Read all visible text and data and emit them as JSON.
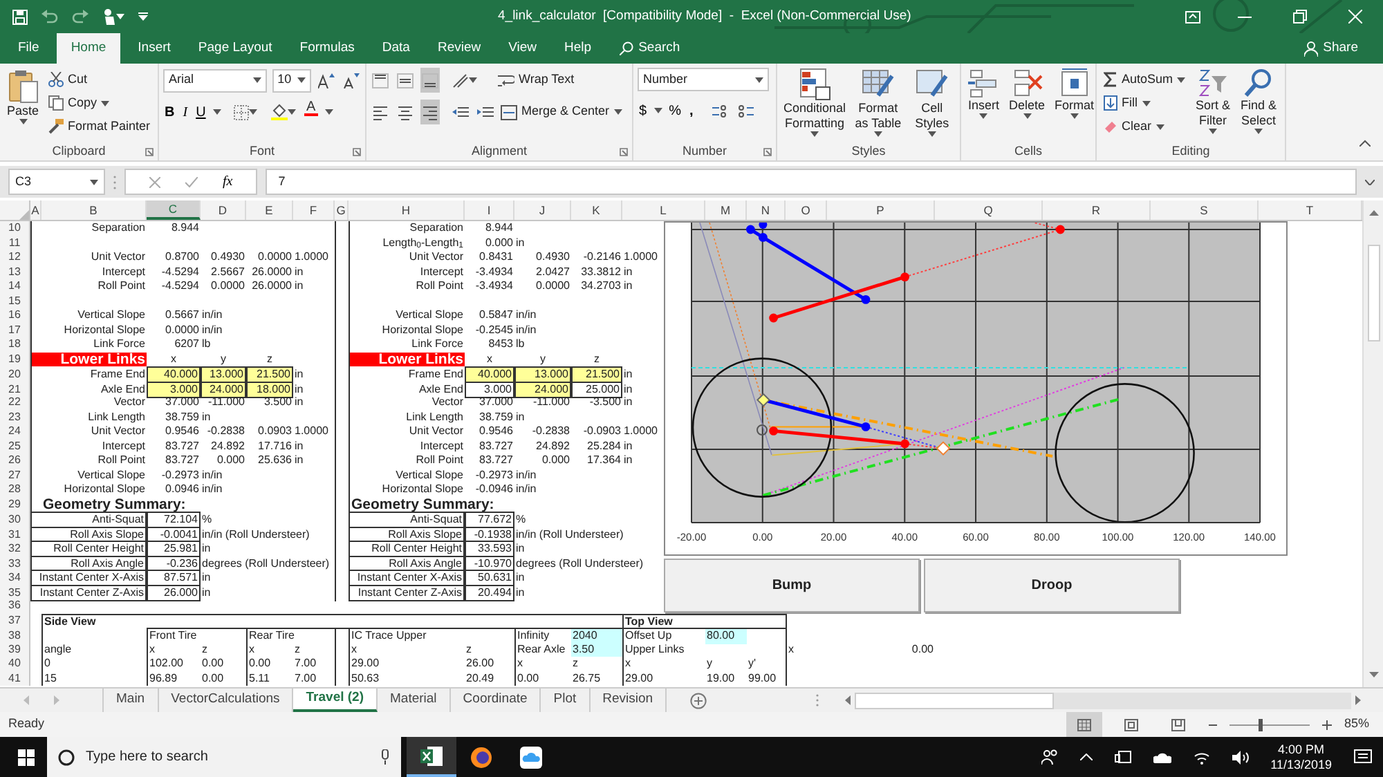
{
  "title_bar": {
    "title": "4_link_calculator  [Compatibility Mode]  -  Excel (Non-Commercial Use)"
  },
  "menu_tabs": [
    {
      "label": "File",
      "selected": false
    },
    {
      "label": "Home",
      "selected": true
    },
    {
      "label": "Insert",
      "selected": false
    },
    {
      "label": "Page Layout",
      "selected": false
    },
    {
      "label": "Formulas",
      "selected": false
    },
    {
      "label": "Data",
      "selected": false
    },
    {
      "label": "Review",
      "selected": false
    },
    {
      "label": "View",
      "selected": false
    },
    {
      "label": "Help",
      "selected": false
    }
  ],
  "search": {
    "label": "Search"
  },
  "share": {
    "label": "Share"
  },
  "ribbon": {
    "clipboard": {
      "label": "Clipboard",
      "paste": "Paste",
      "cut": "Cut",
      "copy": "Copy",
      "format_painter": "Format Painter"
    },
    "font": {
      "label": "Font",
      "font_name": "Arial",
      "font_size": "10",
      "bold": "B",
      "italic": "I",
      "underline": "U",
      "font_color": "A"
    },
    "alignment": {
      "label": "Alignment",
      "wrap_text": "Wrap Text",
      "merge_center": "Merge & Center",
      "vertical_align": [
        {
          "selected": false
        },
        {
          "selected": false
        },
        {
          "selected": true
        }
      ],
      "horizontal_align": [
        {
          "selected": false
        },
        {
          "selected": false
        },
        {
          "selected": true
        }
      ]
    },
    "number": {
      "label": "Number",
      "format": "Number",
      "currency": "$",
      "percent": "%",
      "comma": ","
    },
    "styles": {
      "label": "Styles",
      "buttons": [
        "Conditional Formatting",
        "Format as Table",
        "Cell Styles"
      ]
    },
    "cells": {
      "label": "Cells",
      "buttons": [
        "Insert",
        "Delete",
        "Format"
      ]
    },
    "editing": {
      "label": "Editing",
      "autosum": "AutoSum",
      "fill": "Fill",
      "clear": "Clear",
      "sort_filter": "Sort & Filter",
      "find_select": "Find & Select"
    }
  },
  "formula_bar": {
    "name_box": "C3",
    "fx": "fx",
    "value": "7"
  },
  "columns": [
    {
      "label": "A",
      "selected": false
    },
    {
      "label": "B",
      "selected": false
    },
    {
      "label": "C",
      "selected": true
    },
    {
      "label": "D",
      "selected": false
    },
    {
      "label": "E",
      "selected": false
    },
    {
      "label": "F",
      "selected": false
    },
    {
      "label": "G",
      "selected": false
    },
    {
      "label": "H",
      "selected": false
    },
    {
      "label": "I",
      "selected": false
    },
    {
      "label": "J",
      "selected": false
    },
    {
      "label": "K",
      "selected": false
    },
    {
      "label": "L",
      "selected": false
    },
    {
      "label": "M",
      "selected": false
    },
    {
      "label": "N",
      "selected": false
    },
    {
      "label": "O",
      "selected": false
    },
    {
      "label": "P",
      "selected": false
    },
    {
      "label": "Q",
      "selected": false
    },
    {
      "label": "R",
      "selected": false
    },
    {
      "label": "S",
      "selected": false
    },
    {
      "label": "T",
      "selected": false
    }
  ],
  "rows": [
    {
      "number": "10",
      "left": {
        "kind": "data",
        "label": "Separation",
        "values": [
          "8.944"
        ]
      },
      "right": {
        "kind": "data",
        "label": "Separation",
        "values": [
          "8.944"
        ]
      }
    },
    {
      "number": "11",
      "right": {
        "kind": "data",
        "label": "Length$_{0}$-Length$_{1}$",
        "values": [
          "0.000"
        ],
        "unit": "in"
      }
    },
    {
      "number": "12",
      "left": {
        "kind": "data",
        "label": "Unit Vector",
        "values": [
          "0.8700",
          "0.4930",
          "0.0000",
          "1.0000"
        ]
      },
      "right": {
        "kind": "data",
        "label": "Unit Vector",
        "values": [
          "0.8431",
          "0.4930",
          "-0.2146",
          "1.0000"
        ]
      }
    },
    {
      "number": "13",
      "left": {
        "kind": "data",
        "label": "Intercept",
        "values": [
          "-4.5294",
          "2.5667",
          "26.0000"
        ],
        "unit": "in"
      },
      "right": {
        "kind": "data",
        "label": "Intercept",
        "values": [
          "-3.4934",
          "2.0427",
          "33.3812"
        ],
        "unit": "in"
      }
    },
    {
      "number": "14",
      "left": {
        "kind": "data",
        "label": "Roll Point",
        "values": [
          "-4.5294",
          "0.0000",
          "26.0000"
        ],
        "unit": "in"
      },
      "right": {
        "kind": "data",
        "label": "Roll Point",
        "values": [
          "-3.4934",
          "0.0000",
          "34.2703"
        ],
        "unit": "in"
      }
    },
    {
      "number": "15"
    },
    {
      "number": "16",
      "left": {
        "kind": "data",
        "label": "Vertical Slope",
        "values": [
          "0.5667"
        ],
        "unit": "in/in"
      },
      "right": {
        "kind": "data",
        "label": "Vertical Slope",
        "values": [
          "0.5847"
        ],
        "unit": "in/in"
      }
    },
    {
      "number": "17",
      "left": {
        "kind": "data",
        "label": "Horizontal Slope",
        "values": [
          "0.0000"
        ],
        "unit": "in/in"
      },
      "right": {
        "kind": "data",
        "label": "Horizontal Slope",
        "values": [
          "-0.2545"
        ],
        "unit": "in/in"
      }
    },
    {
      "number": "18",
      "left": {
        "kind": "data",
        "label": "Link Force",
        "values": [
          "6207"
        ],
        "unit": "lb"
      },
      "right": {
        "kind": "data",
        "label": "Link Force",
        "values": [
          "8453"
        ],
        "unit": "lb"
      }
    },
    {
      "number": "19",
      "left": {
        "kind": "banner",
        "label": "Lower Links",
        "values": [
          "x",
          "y",
          "z"
        ]
      },
      "right": {
        "kind": "banner",
        "label": "Lower Links",
        "values": [
          "x",
          "y",
          "z"
        ]
      }
    },
    {
      "number": "20",
      "left": {
        "kind": "input",
        "label": "Frame End",
        "values": [
          {
            "text": "40.000",
            "highlighted": true
          },
          {
            "text": "13.000",
            "highlighted": true
          },
          {
            "text": "21.500",
            "highlighted": true
          }
        ],
        "unit": "in"
      },
      "right": {
        "kind": "input",
        "label": "Frame End",
        "values": [
          {
            "text": "40.000",
            "highlighted": true
          },
          {
            "text": "13.000",
            "highlighted": true
          },
          {
            "text": "21.500",
            "highlighted": true
          }
        ],
        "unit": "in"
      }
    },
    {
      "number": "21",
      "left": {
        "kind": "input",
        "label": "Axle End",
        "values": [
          {
            "text": "3.000",
            "highlighted": true
          },
          {
            "text": "24.000",
            "highlighted": true
          },
          {
            "text": "18.000",
            "highlighted": true
          }
        ],
        "unit": "in"
      },
      "right": {
        "kind": "input",
        "label": "Axle End",
        "values": [
          {
            "text": "3.000",
            "highlighted": false
          },
          {
            "text": "24.000",
            "highlighted": true
          },
          {
            "text": "25.000",
            "highlighted": false
          }
        ],
        "unit": "in"
      }
    },
    {
      "number": "22",
      "left": {
        "kind": "data",
        "label": "Vector",
        "values": [
          "37.000",
          "-11.000",
          "3.500"
        ],
        "unit": "in"
      },
      "right": {
        "kind": "data",
        "label": "Vector",
        "values": [
          "37.000",
          "-11.000",
          "-3.500"
        ],
        "unit": "in"
      }
    },
    {
      "number": "23",
      "left": {
        "kind": "data",
        "label": "Link Length",
        "values": [
          "38.759"
        ],
        "unit": "in"
      },
      "right": {
        "kind": "data",
        "label": "Link Length",
        "values": [
          "38.759"
        ],
        "unit": "in"
      }
    },
    {
      "number": "24",
      "left": {
        "kind": "data",
        "label": "Unit Vector",
        "values": [
          "0.9546",
          "-0.2838",
          "0.0903",
          "1.0000"
        ]
      },
      "right": {
        "kind": "data",
        "label": "Unit Vector",
        "values": [
          "0.9546",
          "-0.2838",
          "-0.0903",
          "1.0000"
        ]
      }
    },
    {
      "number": "25",
      "left": {
        "kind": "data",
        "label": "Intercept",
        "values": [
          "83.727",
          "24.892",
          "17.716"
        ],
        "unit": "in"
      },
      "right": {
        "kind": "data",
        "label": "Intercept",
        "values": [
          "83.727",
          "24.892",
          "25.284"
        ],
        "unit": "in"
      }
    },
    {
      "number": "26",
      "left": {
        "kind": "data",
        "label": "Roll Point",
        "values": [
          "83.727",
          "0.000",
          "25.636"
        ],
        "unit": "in"
      },
      "right": {
        "kind": "data",
        "label": "Roll Point",
        "values": [
          "83.727",
          "0.000",
          "17.364"
        ],
        "unit": "in"
      }
    },
    {
      "number": "27",
      "left": {
        "kind": "data",
        "label": "Vertical Slope",
        "values": [
          "-0.2973"
        ],
        "unit": "in/in"
      },
      "right": {
        "kind": "data",
        "label": "Vertical Slope",
        "values": [
          "-0.2973"
        ],
        "unit": "in/in"
      }
    },
    {
      "number": "28",
      "left": {
        "kind": "data",
        "label": "Horizontal Slope",
        "values": [
          "0.0946"
        ],
        "unit": "in/in"
      },
      "right": {
        "kind": "data",
        "label": "Horizontal Slope",
        "values": [
          "-0.0946"
        ],
        "unit": "in/in"
      }
    },
    {
      "number": "29",
      "left": {
        "kind": "heading",
        "label": "Geometry Summary:"
      },
      "right": {
        "kind": "heading",
        "label": "Geometry Summary:"
      }
    },
    {
      "number": "30",
      "left": {
        "kind": "summary",
        "label": "Anti-Squat",
        "values": [
          "72.104"
        ],
        "unit": "%"
      },
      "right": {
        "kind": "summary",
        "label": "Anti-Squat",
        "values": [
          "77.672"
        ],
        "unit": "%"
      }
    },
    {
      "number": "31",
      "left": {
        "kind": "summary",
        "label": "Roll Axis Slope",
        "values": [
          "-0.0041"
        ],
        "unit": "in/in (Roll Understeer)"
      },
      "right": {
        "kind": "summary",
        "label": "Roll Axis Slope",
        "values": [
          "-0.1938"
        ],
        "unit": "in/in (Roll Understeer)"
      }
    },
    {
      "number": "32",
      "left": {
        "kind": "summary",
        "label": "Roll Center Height",
        "values": [
          "25.981"
        ],
        "unit": "in"
      },
      "right": {
        "kind": "summary",
        "label": "Roll Center Height",
        "values": [
          "33.593"
        ],
        "unit": "in"
      }
    },
    {
      "number": "33",
      "left": {
        "kind": "summary",
        "label": "Roll Axis Angle",
        "values": [
          "-0.236"
        ],
        "unit": "degrees (Roll Understeer)"
      },
      "right": {
        "kind": "summary",
        "label": "Roll Axis Angle",
        "values": [
          "-10.970"
        ],
        "unit": "degrees (Roll Understeer)"
      }
    },
    {
      "number": "34",
      "left": {
        "kind": "summary",
        "label": "Instant Center X-Axis",
        "values": [
          "87.571"
        ],
        "unit": "in"
      },
      "right": {
        "kind": "summary",
        "label": "Instant Center X-Axis",
        "values": [
          "50.631"
        ],
        "unit": "in"
      }
    },
    {
      "number": "35",
      "left": {
        "kind": "summary",
        "label": "Instant Center Z-Axis",
        "values": [
          "26.000"
        ],
        "unit": "in"
      },
      "right": {
        "kind": "summary",
        "label": "Instant Center Z-Axis",
        "values": [
          "20.494"
        ],
        "unit": "in"
      }
    },
    {
      "number": "36"
    },
    {
      "number": "37"
    },
    {
      "number": "38"
    },
    {
      "number": "39"
    },
    {
      "number": "40"
    },
    {
      "number": "41"
    }
  ],
  "side_view": {
    "title": "Side View",
    "angle": {
      "header": "angle",
      "values": [
        "0",
        "15"
      ]
    },
    "tables": [
      {
        "title": "Front Tire",
        "headers": [
          "x",
          "z"
        ],
        "rows": [
          [
            "102.00",
            "0.00"
          ],
          [
            "96.89",
            "0.00"
          ]
        ]
      },
      {
        "title": "Rear Tire",
        "headers": [
          "x",
          "z"
        ],
        "rows": [
          [
            "0.00",
            "7.00"
          ],
          [
            "5.11",
            "7.00"
          ]
        ]
      },
      {
        "title": "IC Trace Upper",
        "headers": [
          "x",
          "z"
        ],
        "rows": [
          [
            "29.00",
            "26.00"
          ],
          [
            "50.63",
            "20.49"
          ]
        ]
      }
    ],
    "settings": [
      {
        "label": "Infinity",
        "value": "2040"
      },
      {
        "label": "Rear Axle",
        "value": "3.50"
      }
    ],
    "rear_axle_point": {
      "headers": [
        "x",
        "z"
      ],
      "values": [
        "0.00",
        "26.75"
      ]
    }
  },
  "top_view": {
    "title": "Top View",
    "offset": {
      "label": "Offset Up",
      "value": "80.00"
    },
    "subtitle": "Upper Links",
    "headers": [
      "x",
      "y",
      "y'"
    ],
    "values": [
      "29.00",
      "19.00",
      "99.00"
    ],
    "extra": {
      "label": "x",
      "value": "0.00"
    }
  },
  "chart": {
    "x_tick_labels": [
      "-20.00",
      "0.00",
      "20.00",
      "40.00",
      "60.00",
      "80.00",
      "100.00",
      "120.00",
      "140.00"
    ]
  },
  "buttons": [
    "Bump",
    "Droop"
  ],
  "sheet_tabs": [
    {
      "label": "Main",
      "selected": false
    },
    {
      "label": "VectorCalculations",
      "selected": false
    },
    {
      "label": "Travel (2)",
      "selected": true
    },
    {
      "label": "Material",
      "selected": false
    },
    {
      "label": "Coordinate",
      "selected": false
    },
    {
      "label": "Plot",
      "selected": false
    },
    {
      "label": "Revision",
      "selected": false
    }
  ],
  "status_bar": {
    "status": "Ready",
    "zoom": "85%",
    "zoom_slider": {
      "level": 0.37
    }
  },
  "taskbar": {
    "search_placeholder": "Type here to search",
    "time": "4:00 PM",
    "date": "11/13/2019"
  }
}
